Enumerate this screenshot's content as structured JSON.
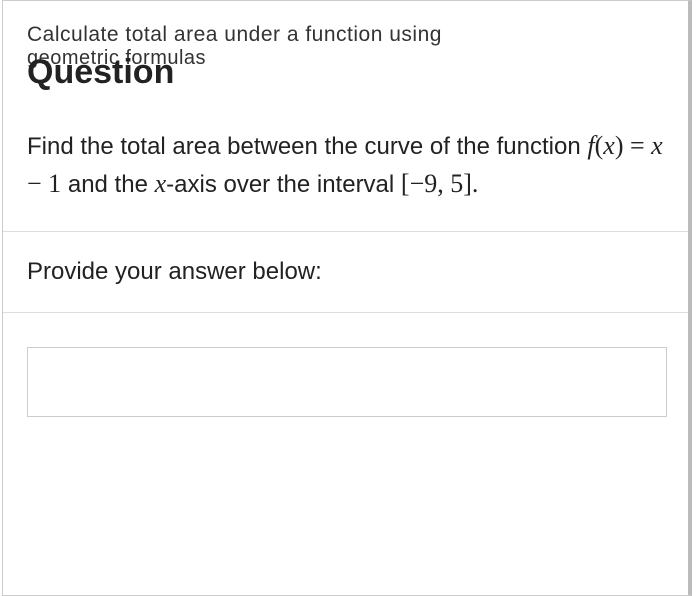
{
  "header": {
    "line1": "Calculate total area under a function using",
    "line2": "geometric formulas",
    "heading": "Question"
  },
  "problem": {
    "text_before": "Find the total area between the curve of the function",
    "func_lhs": "f",
    "func_paren_open": "(",
    "func_var1": "x",
    "func_paren_close": ")",
    "eq": " = ",
    "func_var2": "x",
    "minus": " − 1",
    "text_mid": " and the ",
    "axis_var": "x",
    "text_axis": "-axis over the interval ",
    "interval": "[−9, 5].",
    "prompt": "Provide your answer below:"
  },
  "input": {
    "value": "",
    "placeholder": ""
  }
}
